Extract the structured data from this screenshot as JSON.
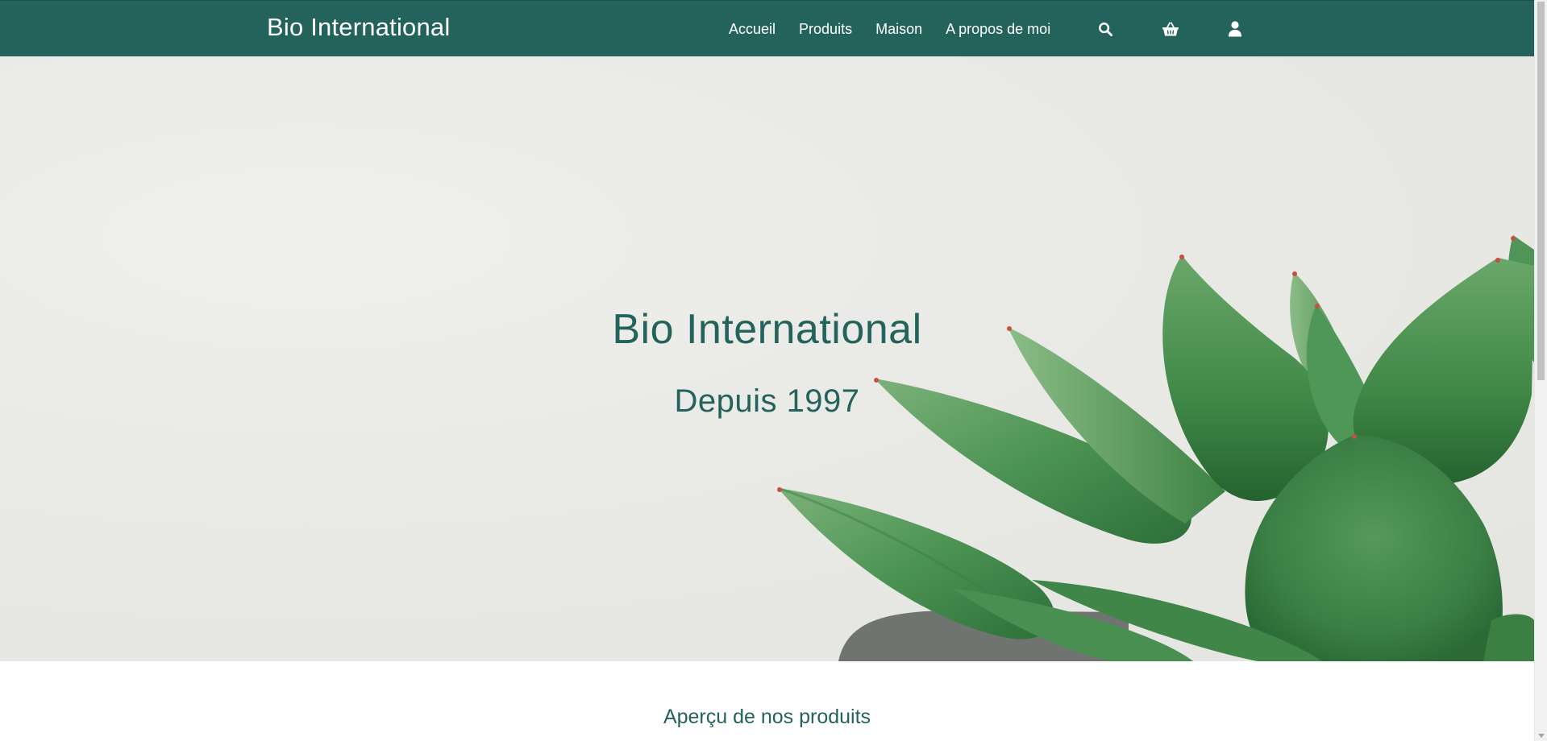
{
  "header": {
    "logo": "Bio International",
    "nav": [
      {
        "label": "Accueil"
      },
      {
        "label": "Produits"
      },
      {
        "label": "Maison"
      },
      {
        "label": "A propos de moi"
      }
    ],
    "icons": [
      "search-icon",
      "basket-icon",
      "user-icon"
    ]
  },
  "hero": {
    "title": "Bio International",
    "subtitle": "Depuis 1997"
  },
  "products": {
    "section_title": "Aperçu de nos produits"
  },
  "colors": {
    "brand": "#24635b",
    "hero_bg": "#e9e9e6",
    "plant_green": "#3f8b4c"
  }
}
